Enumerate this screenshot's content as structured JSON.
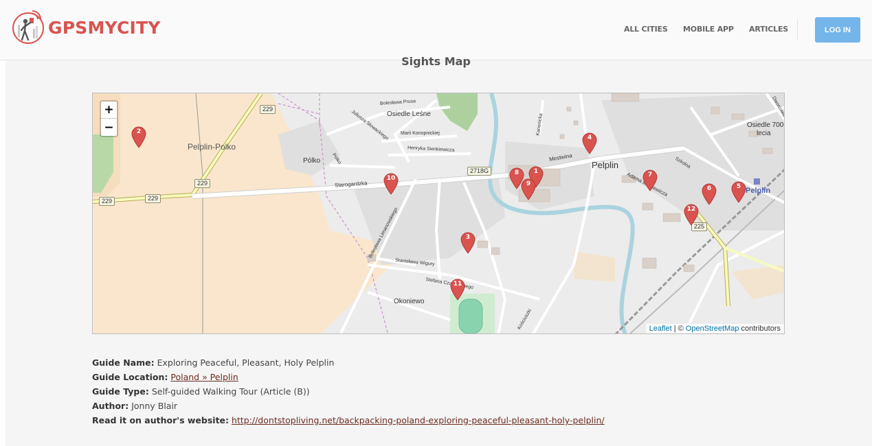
{
  "header": {
    "brand": "GPSMYCITY",
    "nav": [
      "ALL CITIES",
      "MOBILE APP",
      "ARTICLES"
    ],
    "login_label": "LOG IN",
    "brand_color": "#d9534f",
    "accent_color": "#74b5ea"
  },
  "section_title": "Sights Map",
  "map": {
    "zoom_in": "+",
    "zoom_out": "−",
    "attribution": {
      "leaflet": "Leaflet",
      "separator": "| ©",
      "osm": "OpenStreetMap",
      "suffix": "contributors"
    },
    "labels": {
      "pelplin_polko": "Pelplin-Polko",
      "polko": "Pólko",
      "pelplin": "Pelplin",
      "pelplin_station": "Pelplin",
      "osiedle_lesne": "Osiedle Leśne",
      "osiedle_700_a": "Osiedle 700-",
      "osiedle_700_b": "lecia",
      "okoniewo": "Okoniewo",
      "starogardzka": "Starogardzka",
      "mestwina": "Mestwina",
      "boleslawa_prusa": "Bolesława Prusa",
      "marii": "Marii Konopnickiej",
      "henryka": "Henryka Sienkiewicza",
      "juliusza": "Juliusza Słowackiego",
      "stanislawa": "Stanisława Wigury",
      "stefana": "Stefana Czarnieckiego",
      "kanonicka": "Kanonicka",
      "szkolna": "Szkolna",
      "adama": "Adama Mickiewicza",
      "polko_street": "Pólko",
      "limanowskiego": "Bolesława Limanowskiego",
      "kosciuszki": "Kościuszki",
      "dworcowa": "Dworcowa"
    },
    "shields": {
      "s229_a": "229",
      "s229_b": "229",
      "s229_c": "229",
      "s229_d": "229",
      "s2718g": "2718G",
      "s225": "225"
    },
    "markers": [
      "1",
      "2",
      "3",
      "4",
      "5",
      "6",
      "7",
      "8",
      "9",
      "10",
      "11",
      "12"
    ],
    "marker_color": "#d9534f"
  },
  "info": {
    "name_label": "Guide Name:",
    "name_value": "Exploring Peaceful, Pleasant, Holy Pelplin",
    "location_label": "Guide Location:",
    "location_value": "Poland » Pelplin",
    "type_label": "Guide Type:",
    "type_value": "Self-guided Walking Tour (Article (B))",
    "author_label": "Author:",
    "author_value": "Jonny Blair",
    "read_label": "Read it on author's website:",
    "read_value": "http://dontstopliving.net/backpacking-poland-exploring-peaceful-pleasant-holy-pelplin/"
  }
}
